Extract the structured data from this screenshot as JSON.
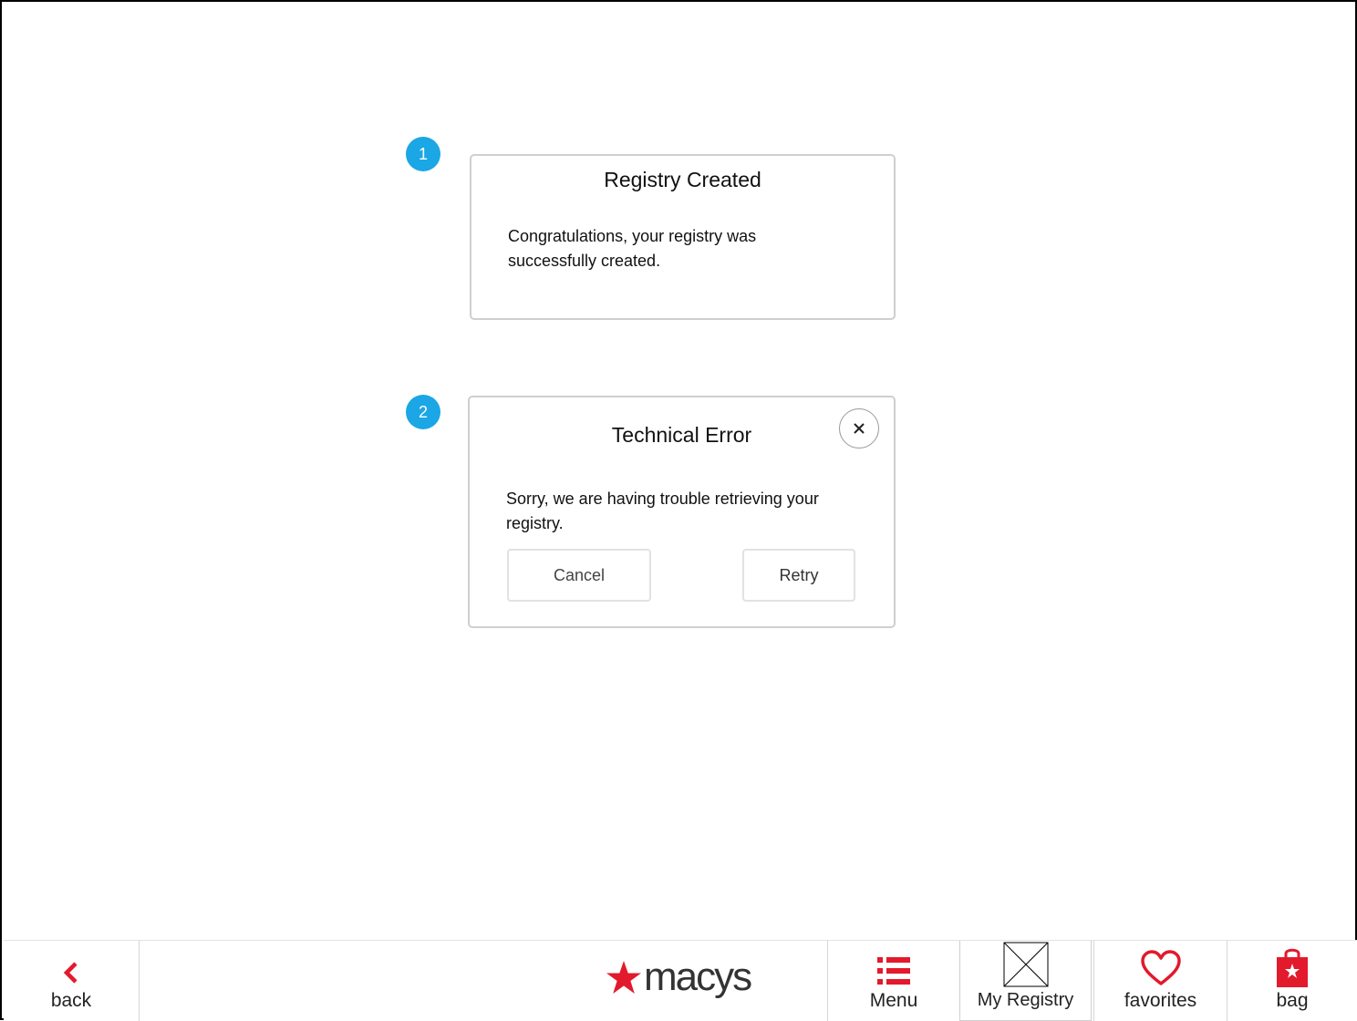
{
  "markers": [
    "1",
    "2"
  ],
  "dialog1": {
    "title": "Registry Created",
    "body_line1": "Congratulations, your registry was",
    "body_line2": "successfully created."
  },
  "dialog2": {
    "title": "Technical Error",
    "body_line1": "Sorry, we are having trouble retrieving your",
    "body_line2": "registry.",
    "cancel_label": "Cancel",
    "retry_label": "Retry",
    "close_icon": "close-icon"
  },
  "tabbar": {
    "back_label": "back",
    "brand_text": "macys",
    "menu_label": "Menu",
    "registry_label": "My Registry",
    "favorites_label": "favorites",
    "bag_label": "bag"
  },
  "colors": {
    "accent_red": "#e21a2c",
    "marker_blue": "#1ba6e6",
    "dialog_border": "#cfcfcf"
  }
}
